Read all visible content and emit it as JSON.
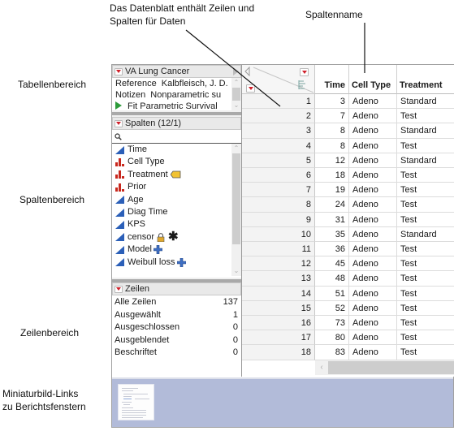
{
  "callouts": {
    "datasheet": [
      "Das Datenblatt enthält Zeilen und",
      "Spalten für Daten"
    ],
    "column_name": "Spaltenname",
    "table_area": "Tabellenbereich",
    "column_area": "Spaltenbereich",
    "row_area": "Zeilenbereich",
    "thumbnails": [
      "Miniaturbild-Links",
      "zu Berichtsfenstern"
    ]
  },
  "table_pane": {
    "title": "VA Lung Cancer",
    "rows": [
      {
        "key": "Reference",
        "value": "Kalbfleisch, J. D."
      },
      {
        "key": "Notizen",
        "value": "Nonparametric su"
      },
      {
        "key": "",
        "value": "Fit Parametric Survival",
        "icon": "play-script-icon"
      }
    ]
  },
  "columns_pane": {
    "title": "Spalten (12/1)",
    "search_placeholder": "",
    "columns": [
      {
        "name": "Time",
        "type": "continuous"
      },
      {
        "name": "Cell Type",
        "type": "nominal"
      },
      {
        "name": "Treatment",
        "type": "nominal",
        "badge": "label-tag-icon"
      },
      {
        "name": "Prior",
        "type": "nominal"
      },
      {
        "name": "Age",
        "type": "continuous"
      },
      {
        "name": "Diag Time",
        "type": "continuous"
      },
      {
        "name": "KPS",
        "type": "continuous"
      },
      {
        "name": "censor",
        "type": "continuous",
        "badge": "lock-icon",
        "badge2": "asterisk-icon"
      },
      {
        "name": "Model",
        "type": "continuous",
        "badge": "formula-plus-icon"
      },
      {
        "name": "Weibull loss",
        "type": "continuous",
        "badge": "formula-plus-icon"
      }
    ]
  },
  "rows_pane": {
    "title": "Zeilen",
    "stats": [
      {
        "label": "Alle Zeilen",
        "value": "137"
      },
      {
        "label": "Ausgewählt",
        "value": "1"
      },
      {
        "label": "Ausgeschlossen",
        "value": "0"
      },
      {
        "label": "Ausgeblendet",
        "value": "0"
      },
      {
        "label": "Beschriftet",
        "value": "0"
      }
    ]
  },
  "grid": {
    "headers": [
      "Time",
      "Cell Type",
      "Treatment"
    ],
    "rows": [
      [
        "1",
        "3",
        "Adeno",
        "Standard"
      ],
      [
        "2",
        "7",
        "Adeno",
        "Test"
      ],
      [
        "3",
        "8",
        "Adeno",
        "Standard"
      ],
      [
        "4",
        "8",
        "Adeno",
        "Test"
      ],
      [
        "5",
        "12",
        "Adeno",
        "Standard"
      ],
      [
        "6",
        "18",
        "Adeno",
        "Test"
      ],
      [
        "7",
        "19",
        "Adeno",
        "Test"
      ],
      [
        "8",
        "24",
        "Adeno",
        "Test"
      ],
      [
        "9",
        "31",
        "Adeno",
        "Test"
      ],
      [
        "10",
        "35",
        "Adeno",
        "Standard"
      ],
      [
        "11",
        "36",
        "Adeno",
        "Test"
      ],
      [
        "12",
        "45",
        "Adeno",
        "Test"
      ],
      [
        "13",
        "48",
        "Adeno",
        "Test"
      ],
      [
        "14",
        "51",
        "Adeno",
        "Test"
      ],
      [
        "15",
        "52",
        "Adeno",
        "Test"
      ],
      [
        "16",
        "73",
        "Adeno",
        "Test"
      ],
      [
        "17",
        "80",
        "Adeno",
        "Test"
      ],
      [
        "18",
        "83",
        "Adeno",
        "Test"
      ]
    ]
  },
  "colors": {
    "thumbnail_strip": "#b2bbd9",
    "red_triangle": "#d0202a",
    "continuous_icon": "#2b5fb8",
    "nominal_icon": "#c8281e",
    "script_play": "#2e9b3a"
  }
}
